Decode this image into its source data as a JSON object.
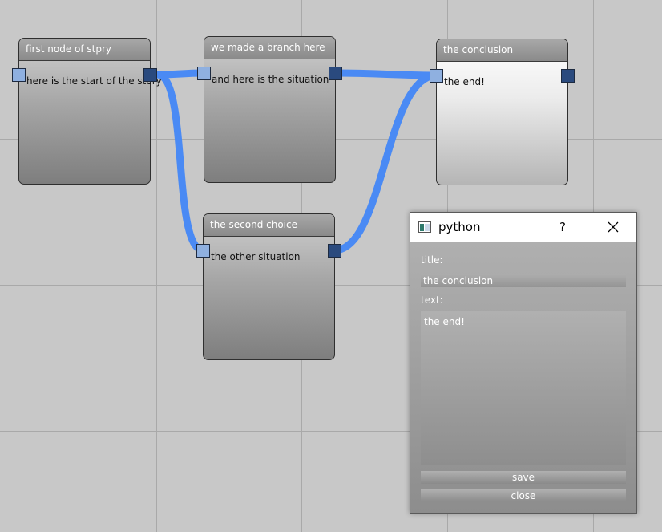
{
  "graph": {
    "nodes": [
      {
        "id": "n1",
        "title": "first node of stpry",
        "text": "here is the start of the story"
      },
      {
        "id": "n2",
        "title": "we made a branch here",
        "text": "and here is the situation"
      },
      {
        "id": "n3",
        "title": "the conclusion",
        "text": "the end!"
      },
      {
        "id": "n4",
        "title": "the second choice",
        "text": "the other situation"
      }
    ],
    "colors": {
      "edge": "#4a8af4",
      "port_in": "#8fb0e0",
      "port_out": "#2a4a7e",
      "background": "#c8c8c8"
    }
  },
  "dialog": {
    "window_title": "python",
    "help": "?",
    "title_label": "title:",
    "title_value": "the conclusion",
    "text_label": "text:",
    "text_value": "the end!",
    "save_label": "save",
    "close_label": "close"
  }
}
